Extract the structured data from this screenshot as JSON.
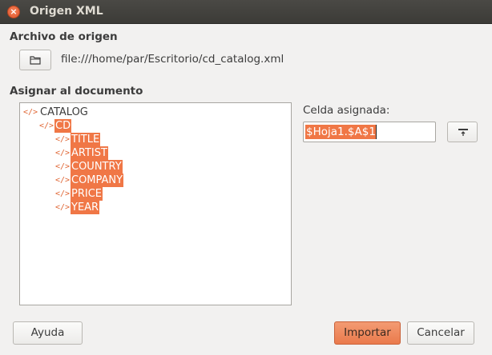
{
  "window": {
    "title": "Origen XML"
  },
  "source": {
    "section_label": "Archivo de origen",
    "browse_icon": "folder-icon",
    "file_path": "file:///home/par/Escritorio/cd_catalog.xml"
  },
  "mapping": {
    "section_label": "Asignar al documento",
    "tree": {
      "root": "CATALOG",
      "child": "CD",
      "leaves": [
        "TITLE",
        "ARTIST",
        "COUNTRY",
        "COMPANY",
        "PRICE",
        "YEAR"
      ],
      "node_icon": "xml-tag-icon"
    },
    "cell_label": "Celda asignada:",
    "cell_value": "$Hoja1.$A$1",
    "shrink_icon": "shrink-dialog-icon"
  },
  "buttons": {
    "help": "Ayuda",
    "import": "Importar",
    "cancel": "Cancelar"
  },
  "colors": {
    "accent": "#f07746",
    "titlebar": "#3c3b37",
    "background": "#f2f1f0"
  }
}
